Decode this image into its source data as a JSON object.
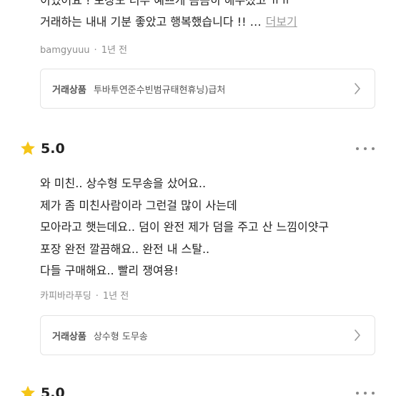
{
  "reviews": [
    {
      "lines": [
        "이었어요 ! 포장도 너무 예쁘게 꼼꼼히 해주셨고 ㅠㅠ",
        "거래하는 내내 기분 좋았고 행복했습니다 !!  …"
      ],
      "more_label": "더보기",
      "author": "bamgyuuu",
      "time": "1년 전",
      "product_label": "거래상품",
      "product_name": "투바투연준수빈범규태현휴닝)급처"
    },
    {
      "rating": "5.0",
      "lines": [
        "와 미친.. 상수형 도무송을 샀어요..",
        "제가 좀 미친사람이라 그런걸 많이 사는데",
        "모아라고 햇는데요.. 덤이 완전 제가 덤을 주고 산 느낌이얏구",
        "포장 완전 깔끔해요.. 완전 내 스탈..",
        "다들 구매해요.. 빨리 쟁여용!"
      ],
      "author": "카피바라푸딩",
      "time": "1년 전",
      "product_label": "거래상품",
      "product_name": "상수형 도무송"
    },
    {
      "rating": "5.0"
    }
  ],
  "separator": "·",
  "icons": {
    "star": "star-icon",
    "more": "more-horizontal-icon",
    "chevron": "chevron-right-icon"
  },
  "colors": {
    "star": "#F5C518",
    "meta": "#8e8e8e",
    "border": "#e3e3e3"
  }
}
